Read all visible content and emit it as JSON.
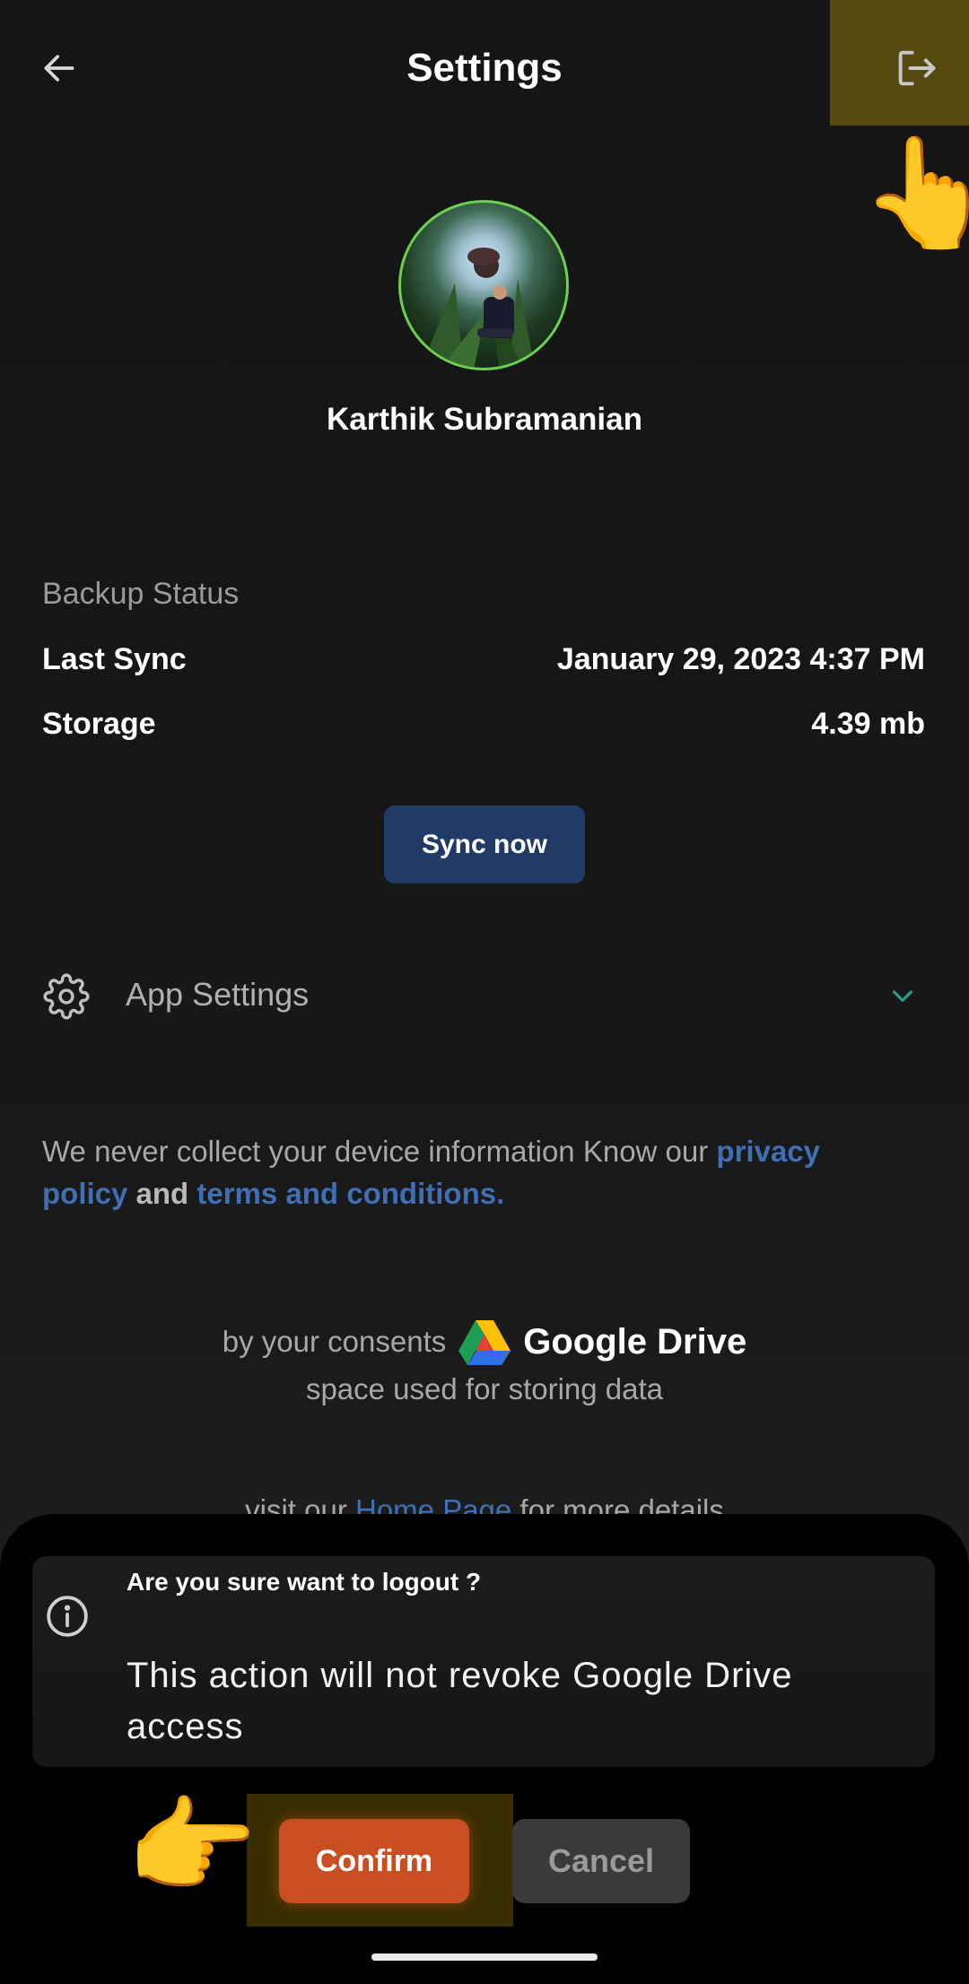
{
  "header": {
    "title": "Settings",
    "back_icon": "arrow-left-icon",
    "logout_icon": "logout-icon"
  },
  "profile": {
    "name": "Karthik Subramanian"
  },
  "backup": {
    "title": "Backup Status",
    "last_sync_label": "Last Sync",
    "last_sync_value": "January 29, 2023 4:37 PM",
    "storage_label": "Storage",
    "storage_value": "4.39 mb",
    "sync_button": "Sync now"
  },
  "app_settings": {
    "label": "App Settings",
    "icon": "gear-icon",
    "expand_icon": "chevron-down-icon"
  },
  "privacy": {
    "text_before": "We never collect your device information Know our ",
    "privacy_link": "privacy policy",
    "and_text": " and ",
    "terms_link": "terms and conditions."
  },
  "drive": {
    "consent_text": "by your consents",
    "brand": "Google Drive",
    "space_text": "space used for storing data"
  },
  "visit": {
    "prefix": "visit our ",
    "link": "Home Page",
    "suffix": " for more details"
  },
  "dialog": {
    "title": "Are you sure want to logout ?",
    "body": "This action will not revoke Google Drive access",
    "confirm_label": "Confirm",
    "cancel_label": "Cancel",
    "info_icon": "info-icon"
  },
  "colors": {
    "accent_blue": "#1f3b66",
    "link_blue": "#3f6fb5",
    "confirm_orange": "#c94f22",
    "highlight_yellow": "#ffd200",
    "avatar_ring": "#6fcf50"
  }
}
